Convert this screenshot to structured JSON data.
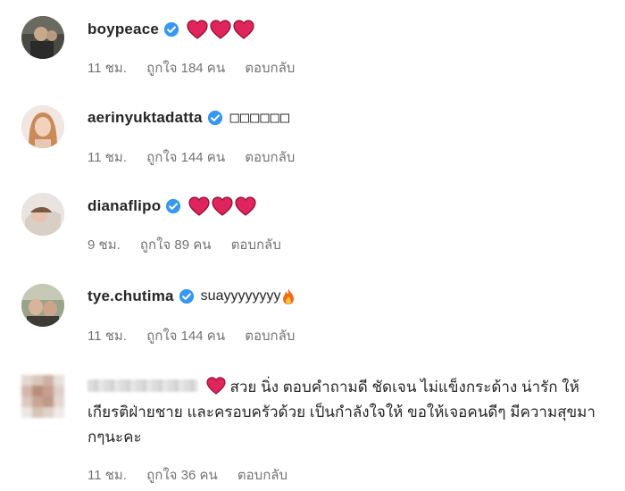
{
  "comments": [
    {
      "username": "boypeace",
      "text": "",
      "time": "11 ชม.",
      "likes": "ถูกใจ 184 คน",
      "reply": "ตอบกลับ",
      "verified": true,
      "reaction_icons": [
        "heart-icon",
        "heart-icon",
        "heart-icon"
      ]
    },
    {
      "username": "aerinyuktadatta",
      "text": "□□□□□□",
      "time": "11 ชม.",
      "likes": "ถูกใจ 144 คน",
      "reply": "ตอบกลับ",
      "verified": true
    },
    {
      "username": "dianaflipo",
      "text": "",
      "time": "9 ชม.",
      "likes": "ถูกใจ 89 คน",
      "reply": "ตอบกลับ",
      "verified": true,
      "reaction_icons": [
        "heart-icon",
        "heart-icon",
        "heart-icon"
      ]
    },
    {
      "username": "tye.chutima",
      "text": "suayyyyyyyy",
      "time": "11 ชม.",
      "likes": "ถูกใจ 144 คน",
      "reply": "ตอบกลับ",
      "verified": true,
      "reaction_icons": [
        "fire-icon"
      ]
    },
    {
      "username": "",
      "text": "สวย นิ่ง ตอบคำถามดี ชัดเจน ไม่แข็งกระด้าง น่ารัก ให้เกียรติฝ่ายชาย และครอบครัวด้วย เป็นกำลังใจให้ ขอให้เจอคนดีๆ มีความสุขมากๆนะคะ",
      "time": "11 ชม.",
      "likes": "ถูกใจ 36 คน",
      "reply": "ตอบกลับ",
      "verified": false,
      "username_blurred": true,
      "reaction_icons": [
        "heart-icon"
      ]
    }
  ],
  "colors": {
    "username": "#262626",
    "meta": "#737373",
    "verified_badge": "#3897f0",
    "heart": "#e0245e"
  }
}
